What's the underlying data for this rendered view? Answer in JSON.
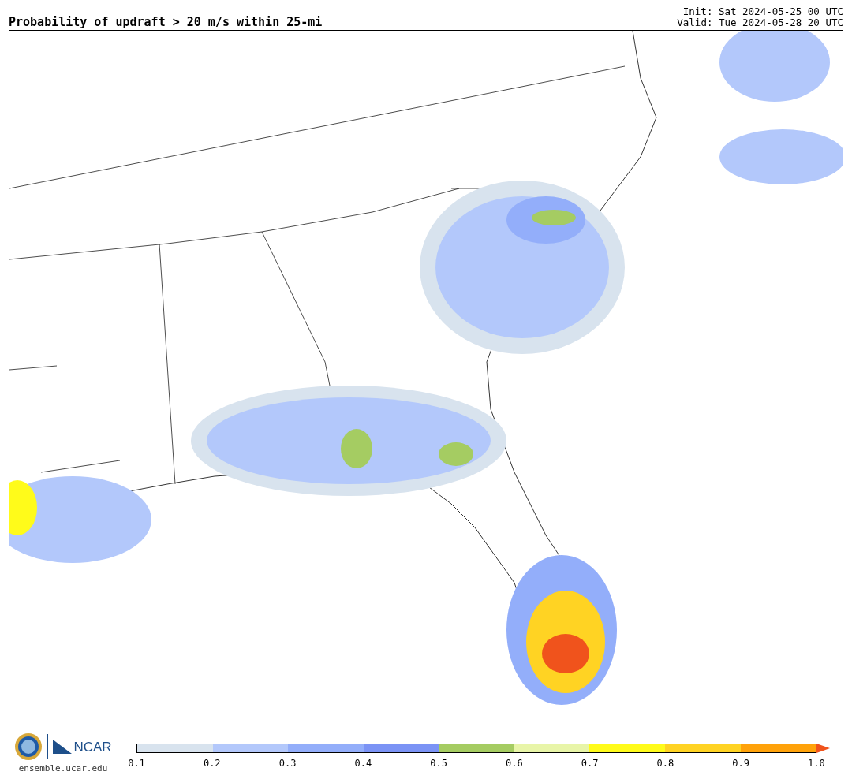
{
  "title": "Probability of updraft > 20 m/s within 25-mi",
  "init": "Init: Sat 2024-05-25 00 UTC",
  "valid": "Valid: Tue 2024-05-28 20 UTC",
  "logos": {
    "ncar": "NCAR",
    "site": "ensemble.ucar.edu"
  },
  "colorbar": {
    "bins": [
      {
        "color": "#d8e3ee"
      },
      {
        "color": "#b3c8fb"
      },
      {
        "color": "#93aefa"
      },
      {
        "color": "#7b93f5"
      },
      {
        "color": "#a5cc62"
      },
      {
        "color": "#e8f5a8"
      },
      {
        "color": "#fffb1a"
      },
      {
        "color": "#ffd323"
      },
      {
        "color": "#ffa20a"
      },
      {
        "kind": "arrow",
        "color": "#f0531c"
      }
    ],
    "ticks": [
      "0.1",
      "0.2",
      "0.3",
      "0.4",
      "0.5",
      "0.6",
      "0.7",
      "0.8",
      "0.9",
      "1.0"
    ]
  }
}
